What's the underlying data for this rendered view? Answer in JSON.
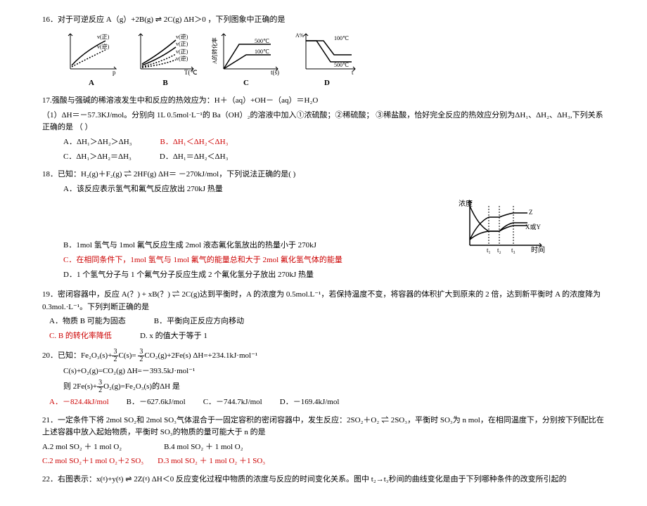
{
  "q16": {
    "text": "16．对于可逆反应 A（g）+2B(g) ⇌ 2C(g) ΔH＞0 ，下列图象中正确的是",
    "labels": {
      "a": "A",
      "b": "B",
      "c": "C",
      "d": "D"
    },
    "diag_a": {
      "xaxis": "p",
      "lines": [
        "v(正)",
        "v(逆)"
      ]
    },
    "diag_b": {
      "xaxis": "T(℃)",
      "lines": [
        "v(逆)",
        "v(正)",
        "v(正)",
        "v(逆)"
      ]
    },
    "diag_c": {
      "xaxis": "t(s)",
      "ylabel": "A的转化率",
      "lines": [
        "500℃",
        "100℃"
      ]
    },
    "diag_d": {
      "xaxis": "t",
      "ylabel": "A%",
      "lines": [
        "100℃",
        "500℃"
      ]
    }
  },
  "q17": {
    "text": "17.强酸与强碱的稀溶液发生中和反应的热效应为：H＋（aq）+OH－（aq）＝H₂O",
    "sub": "（1）ΔH＝－57.3KJ/mol。分别向 1L 0.5mol·L⁻¹的 Ba（OH）₂的溶液中加入①浓硫酸；②稀硫酸；  ③稀盐酸，恰好完全反应的热效应分别为ΔH₁、ΔH₂、ΔH₃,下列关系正确的是 （    ）",
    "optA": "A．ΔH₁＞ΔH₂＞ΔH₃",
    "optB": "B．ΔH₁＜ΔH₂＜ΔH₃",
    "optC": "C．ΔH₁＞ΔH₂＝ΔH₃",
    "optD": "D．ΔH₁＝ΔH₂＜ΔH₃"
  },
  "q18": {
    "text": "18．已知：H₂(g)＋F₂(g)  ⇌  2HF(g)    ΔH＝ －270kJ/mol，下列说法正确的是(     )",
    "optA": "A．该反应表示氢气和氟气反应放出 270kJ 热量",
    "optB": "B．1mol 氢气与 1mol 氟气反应生成 2mol 液态氟化氢放出的热量小于 270kJ",
    "optC": "C．在相同条件下，1mol 氢气与 1mol 氟气的能量总和大于 2mol 氟化氢气体的能量",
    "optD": "D．1 个氢气分子与 1 个氟气分子反应生成 2 个氟化氢分子放出 270kJ 热量",
    "diag": {
      "ylabel": "浓度",
      "xlabel": "时间",
      "ticks": [
        "t₁",
        "t₂",
        "t₃"
      ],
      "series": [
        "Z",
        "X或Y"
      ]
    }
  },
  "q19": {
    "text": "19．密闭容器中，反应 A(？) + xB(？) ⇌ 2C(g)达到平衡时，A 的浓度为 0.5mol.L⁻¹，若保持温度不变，将容器的体积扩大到原来的 2 倍，达到新平衡时 A 的浓度降为 0.3mol.·L⁻¹。下列判断正确的是",
    "optA": "A．物质 B 可能为固态",
    "optB": "B．平衡向正反应方向移动",
    "optC": "C. B 的转化率降低",
    "optD": "D. x 的值大于等于 1"
  },
  "q20": {
    "text": "20．已知：Fe₂O₃(s)+",
    "text2": "C(s)=",
    "text3": "CO₂(g)+2Fe(s)    ΔH=+234.1kJ·mol⁻¹",
    "line2a": "C(s)+O₂(g)=CO₂(g)      ΔH=－393.5kJ·mol⁻¹",
    "line3a": "则 2Fe(s)+",
    "line3b": "O₂(g)=Fe₂O₃(s)的ΔH 是",
    "optA": "A．－824.4kJ/mol",
    "optB": "B．－627.6kJ/mol",
    "optC": "C．－744.7kJ/mol",
    "optD": "D．－169.4kJ/mol",
    "frac_num": "3",
    "frac_den": "2"
  },
  "q21": {
    "text": "21．一定条件下将 2mol SO₂和 2mol SO₃气体混合于一固定容积的密闭容器中，发生反应：2SO₂＋O₂  ⇌  2SO₃，平衡时 SO₃为 n mol，在相同温度下，分别按下列配比在上述容器中放入起始物质，平衡时 SO₃的物质的量可能大于 n 的是",
    "optA": "A.2 mol SO₂ ＋ 1 mol O₂",
    "optB": "B.4 mol SO₂ ＋ 1 mol O₂",
    "optC": "C.2 mol SO₂＋1 mol O₂＋2 SO₃",
    "optD": "D.3 mol SO₂ ＋ 1 mol O₂ ＋1 SO₃"
  },
  "q22": {
    "text": "22．右图表示：x(ᵍ)+y(ᵍ) ⇌ 2Z(ᵍ) ΔH＜0 反应变化过程中物质的浓度与反应的时间变化关系。图中 t₂→t₃秒间的曲线变化是由于下列哪种条件的改变所引起的"
  }
}
